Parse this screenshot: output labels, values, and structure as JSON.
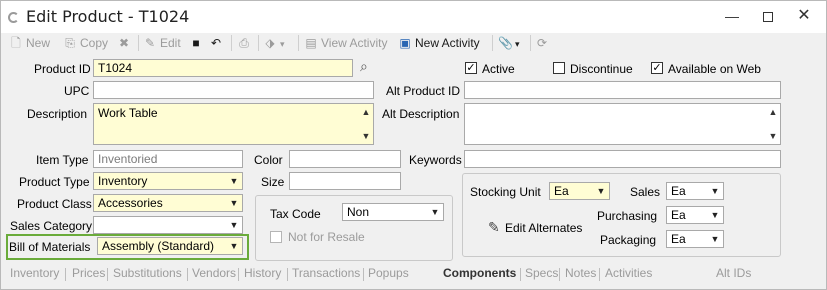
{
  "window": {
    "title": "Edit Product - T1024",
    "controls": {
      "minimize": "—",
      "close": "✕"
    }
  },
  "toolbar": {
    "new": "New",
    "copy": "Copy",
    "edit": "Edit",
    "view_activity": "View Activity",
    "new_activity": "New Activity"
  },
  "form": {
    "product_id": {
      "label": "Product ID",
      "value": "T1024"
    },
    "upc": {
      "label": "UPC",
      "value": ""
    },
    "description": {
      "label": "Description",
      "value": "Work Table"
    },
    "item_type": {
      "label": "Item Type",
      "value": "Inventoried"
    },
    "product_type": {
      "label": "Product Type",
      "value": "Inventory"
    },
    "product_class": {
      "label": "Product Class",
      "value": "Accessories"
    },
    "sales_category": {
      "label": "Sales Category",
      "value": ""
    },
    "bill_of_materials": {
      "label": "Bill of Materials",
      "value": "Assembly (Standard)"
    },
    "color": {
      "label": "Color",
      "value": ""
    },
    "size": {
      "label": "Size",
      "value": ""
    },
    "tax_code": {
      "label": "Tax Code",
      "value": "Non"
    },
    "not_for_resale": {
      "label": "Not for Resale",
      "checked": false
    },
    "active": {
      "label": "Active",
      "checked": true
    },
    "discontinue": {
      "label": "Discontinue",
      "checked": false
    },
    "available_on_web": {
      "label": "Available on Web",
      "checked": true
    },
    "alt_product_id": {
      "label": "Alt Product ID",
      "value": ""
    },
    "alt_description": {
      "label": "Alt Description",
      "value": ""
    },
    "keywords": {
      "label": "Keywords",
      "value": ""
    },
    "stocking_unit": {
      "label": "Stocking Unit",
      "value": "Ea"
    },
    "sales_unit": {
      "label": "Sales",
      "value": "Ea"
    },
    "purchasing_unit": {
      "label": "Purchasing",
      "value": "Ea"
    },
    "packaging_unit": {
      "label": "Packaging",
      "value": "Ea"
    },
    "edit_alternates": "Edit Alternates"
  },
  "tabs": [
    {
      "label": "Inventory",
      "active": false
    },
    {
      "label": "Prices",
      "active": false
    },
    {
      "label": "Substitutions",
      "active": false
    },
    {
      "label": "Vendors",
      "active": false
    },
    {
      "label": "History",
      "active": false
    },
    {
      "label": "Transactions",
      "active": false
    },
    {
      "label": "Popups",
      "active": false
    },
    {
      "label": "Components",
      "active": true
    },
    {
      "label": "Specs",
      "active": false
    },
    {
      "label": "Notes",
      "active": false
    },
    {
      "label": "Activities",
      "active": false
    },
    {
      "label": "Alt IDs",
      "active": false
    }
  ],
  "colors": {
    "highlight_border": "#6aab3a",
    "required_field_bg": "#fffdd4",
    "disabled_text": "#9b9b9b"
  },
  "icons": [
    "new-icon",
    "copy-icon",
    "delete-icon",
    "edit-icon",
    "save-icon",
    "undo-icon",
    "print-icon",
    "tag-icon",
    "view-activity-icon",
    "new-activity-icon",
    "attach-icon",
    "refresh-icon",
    "search-icon",
    "pencil-icon"
  ]
}
